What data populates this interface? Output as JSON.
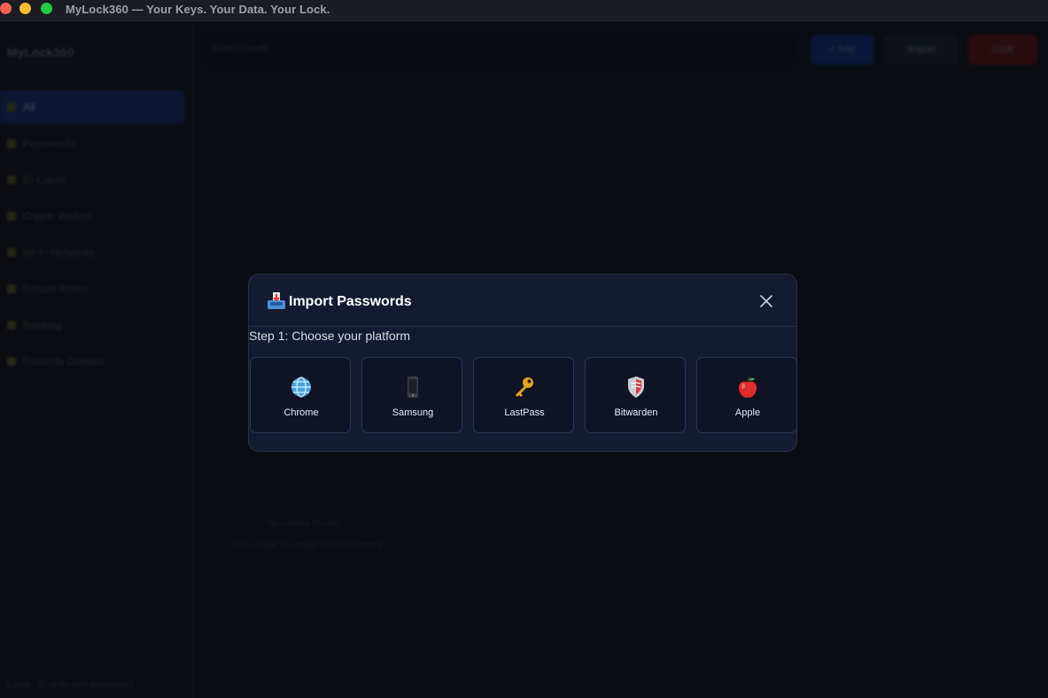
{
  "window": {
    "title": "MyLock360 — Your Keys. Your Data. Your Lock."
  },
  "background": {
    "brand": "MyLock360",
    "nav_items": [
      "All",
      "Passwords",
      "ID Cards",
      "Crypto Wallets",
      "Wi-Fi Networks",
      "Secure Notes",
      "Banking",
      "Recently Deleted"
    ],
    "search_placeholder": "Search vault...",
    "buttons": {
      "add": "+ Add",
      "import": "Import",
      "lock": "Lock"
    },
    "empty_title": "No entries found",
    "empty_subtitle": "Click + Add to create your first entry",
    "footer": "Local · End-to-end encrypted"
  },
  "modal": {
    "title": "Import Passwords",
    "title_icon": "inbox-tray-icon",
    "close_icon": "close-icon",
    "step_label": "Step 1: Choose your platform",
    "platforms": [
      {
        "label": "Chrome",
        "icon": "globe-icon"
      },
      {
        "label": "Samsung",
        "icon": "mobile-phone-icon"
      },
      {
        "label": "LastPass",
        "icon": "key-icon"
      },
      {
        "label": "Bitwarden",
        "icon": "shield-icon"
      },
      {
        "label": "Apple",
        "icon": "apple-icon"
      }
    ]
  },
  "colors": {
    "modal_bg": "#141b30",
    "card_border": "#2a3552",
    "accent_active": "#0f2045"
  }
}
